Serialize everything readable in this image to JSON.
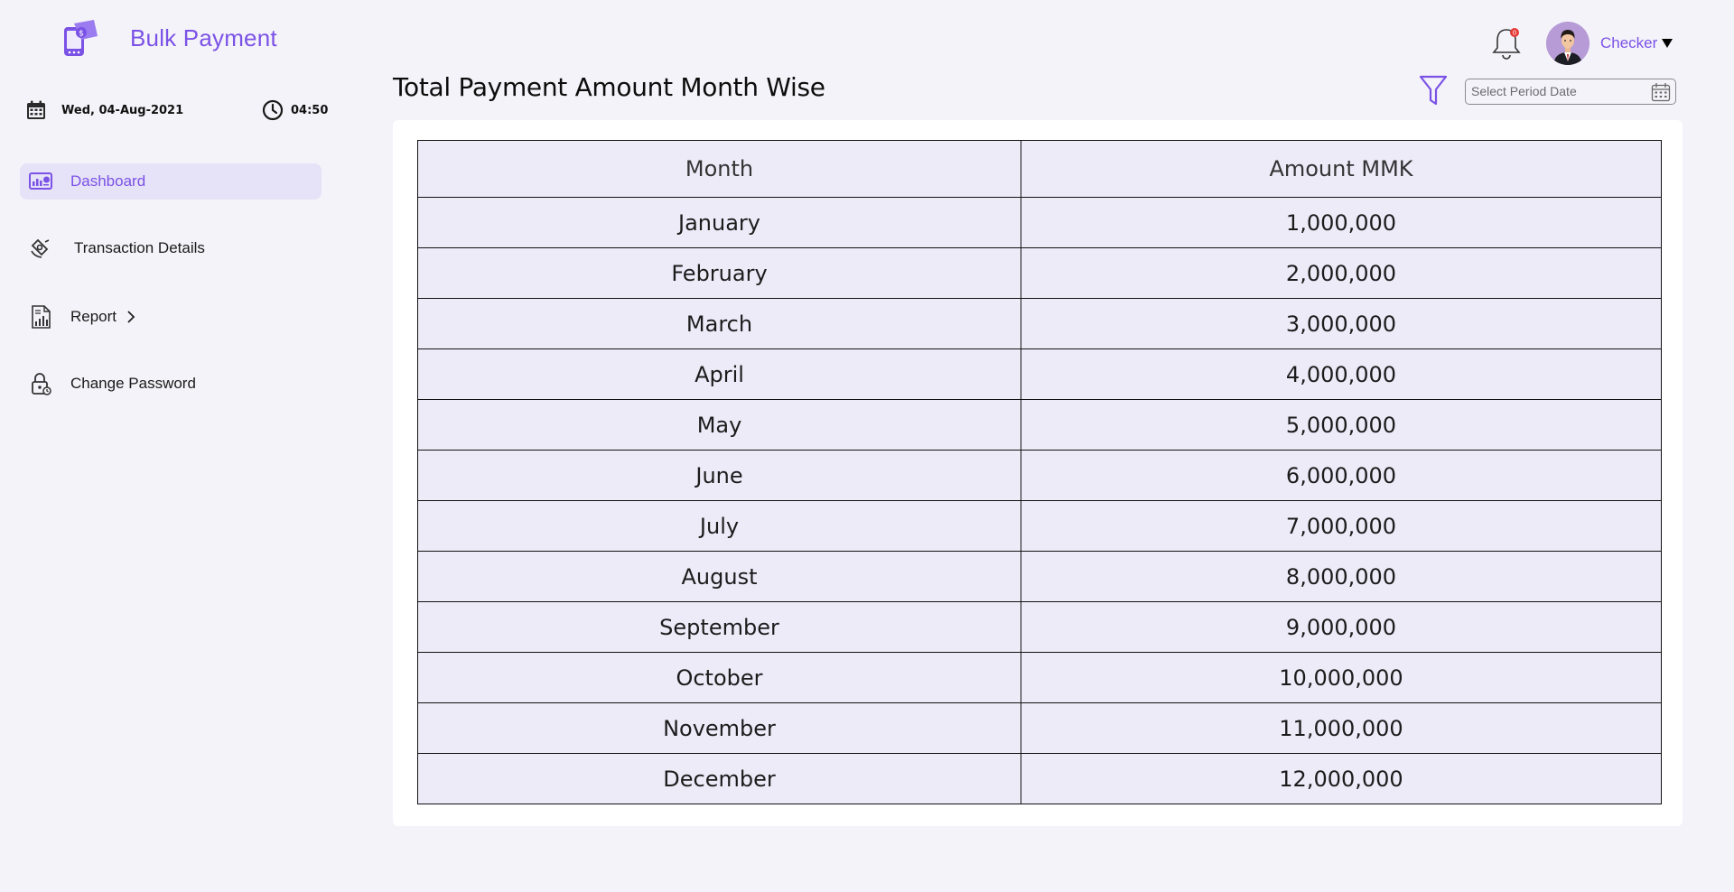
{
  "app": {
    "title": "Bulk Payment"
  },
  "datetime": {
    "date": "Wed, 04-Aug-2021",
    "time": "04:50"
  },
  "sidebar": {
    "items": [
      {
        "label": "Dashboard",
        "icon": "dashboard-icon",
        "active": true
      },
      {
        "label": "Transaction Details",
        "icon": "transaction-icon",
        "active": false
      },
      {
        "label": "Report",
        "icon": "report-icon",
        "active": false,
        "has_submenu": true
      },
      {
        "label": "Change Password",
        "icon": "lock-icon",
        "active": false
      }
    ]
  },
  "header": {
    "notification_count": "0",
    "user_name": "Checker"
  },
  "main": {
    "title": "Total Payment Amount Month Wise",
    "filter": {
      "placeholder": "Select Period Date"
    },
    "table": {
      "columns": [
        "Month",
        "Amount MMK"
      ],
      "rows": [
        {
          "month": "January",
          "amount": "1,000,000"
        },
        {
          "month": "February",
          "amount": "2,000,000"
        },
        {
          "month": "March",
          "amount": "3,000,000"
        },
        {
          "month": "April",
          "amount": "4,000,000"
        },
        {
          "month": "May",
          "amount": "5,000,000"
        },
        {
          "month": "June",
          "amount": "6,000,000"
        },
        {
          "month": "July",
          "amount": "7,000,000"
        },
        {
          "month": "August",
          "amount": "8,000,000"
        },
        {
          "month": "September",
          "amount": "9,000,000"
        },
        {
          "month": "October",
          "amount": "10,000,000"
        },
        {
          "month": "November",
          "amount": "11,000,000"
        },
        {
          "month": "December",
          "amount": "12,000,000"
        }
      ]
    }
  },
  "colors": {
    "accent": "#7b52e6",
    "background": "#f4f3f9",
    "active_nav": "#e6e2f7",
    "table_bg": "#eeebf9",
    "badge": "#e53935"
  }
}
